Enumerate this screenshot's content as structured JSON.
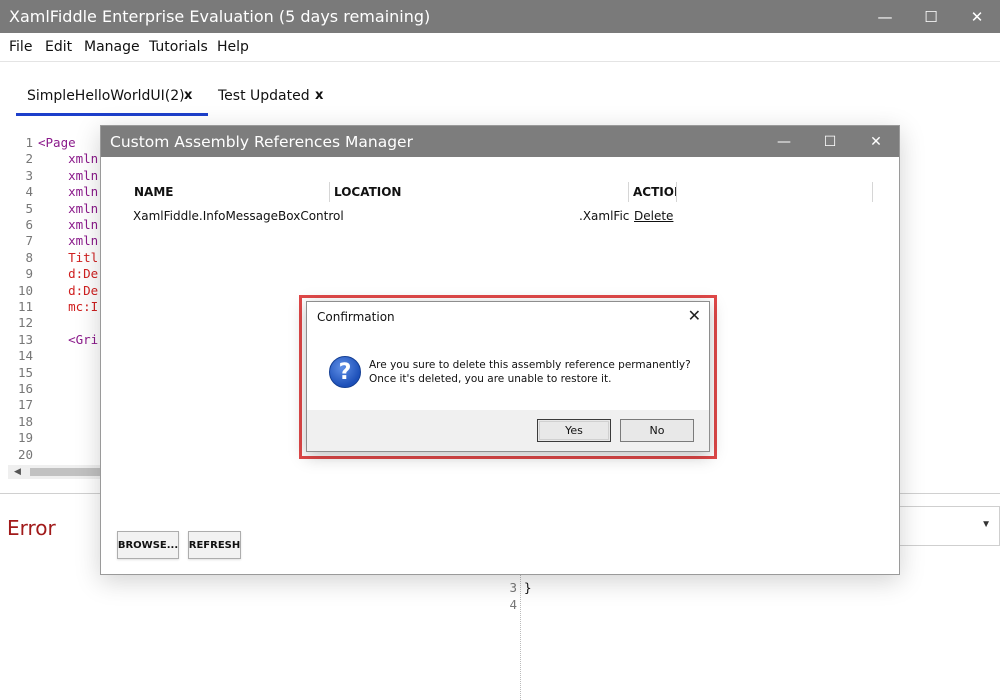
{
  "window": {
    "title": "XamlFiddle Enterprise Evaluation (5 days remaining)",
    "min_glyph": "—",
    "max_glyph": "☐",
    "close_glyph": "✕"
  },
  "menu": [
    "File",
    "Edit",
    "Manage",
    "Tutorials",
    "Help"
  ],
  "tabs": [
    {
      "label": "SimpleHelloWorldUI(2)",
      "close": "x",
      "active": true
    },
    {
      "label": "Test Updated",
      "close": "x",
      "active": false
    }
  ],
  "editor": {
    "line_numbers": [
      "1",
      "2",
      "3",
      "4",
      "5",
      "6",
      "7",
      "8",
      "9",
      "10",
      "11",
      "12",
      "13",
      "14",
      "15",
      "16",
      "17",
      "18",
      "19",
      "20"
    ],
    "lines": [
      {
        "text": "<Page",
        "color": "#8b1a8b"
      },
      {
        "text": "    xmln",
        "color": "#8b1a8b"
      },
      {
        "text": "    xmln",
        "color": "#8b1a8b"
      },
      {
        "text": "    xmln",
        "color": "#8b1a8b"
      },
      {
        "text": "    xmln",
        "color": "#8b1a8b"
      },
      {
        "text": "    xmln",
        "color": "#8b1a8b"
      },
      {
        "text": "    xmln",
        "color": "#8b1a8b"
      },
      {
        "text": "    Titl",
        "color": "#d02020"
      },
      {
        "text": "    d:De",
        "color": "#d02020"
      },
      {
        "text": "    d:De",
        "color": "#d02020"
      },
      {
        "text": "    mc:I",
        "color": "#d02020"
      },
      {
        "text": "",
        "color": "#111"
      },
      {
        "text": "    <Gri",
        "color": "#8b1a8b"
      }
    ]
  },
  "error_label": "Error",
  "bottom_editor": {
    "line_numbers": [
      "3",
      "4"
    ],
    "code": "}"
  },
  "crm": {
    "title": "Custom Assembly References Manager",
    "columns": [
      "NAME",
      "LOCATION",
      "ACTIOI"
    ],
    "rows": [
      {
        "name": "XamlFiddle.InfoMessageBoxControl",
        "location": ".XamlFic",
        "action": "Delete"
      }
    ],
    "browse_label": "BROWSE...",
    "refresh_label": "REFRESH"
  },
  "confirm": {
    "title": "Confirmation",
    "close_glyph": "✕",
    "icon_glyph": "?",
    "message_line1": "Are you sure to delete this assembly reference permanently?",
    "message_line2": "Once it's deleted, you are unable to restore it.",
    "yes_label": "Yes",
    "no_label": "No"
  },
  "colors": {
    "title_bar": "#7a7a7a",
    "tab_underline": "#1d3fcb",
    "error_text": "#a11a1a",
    "highlight_border": "#e04848"
  }
}
